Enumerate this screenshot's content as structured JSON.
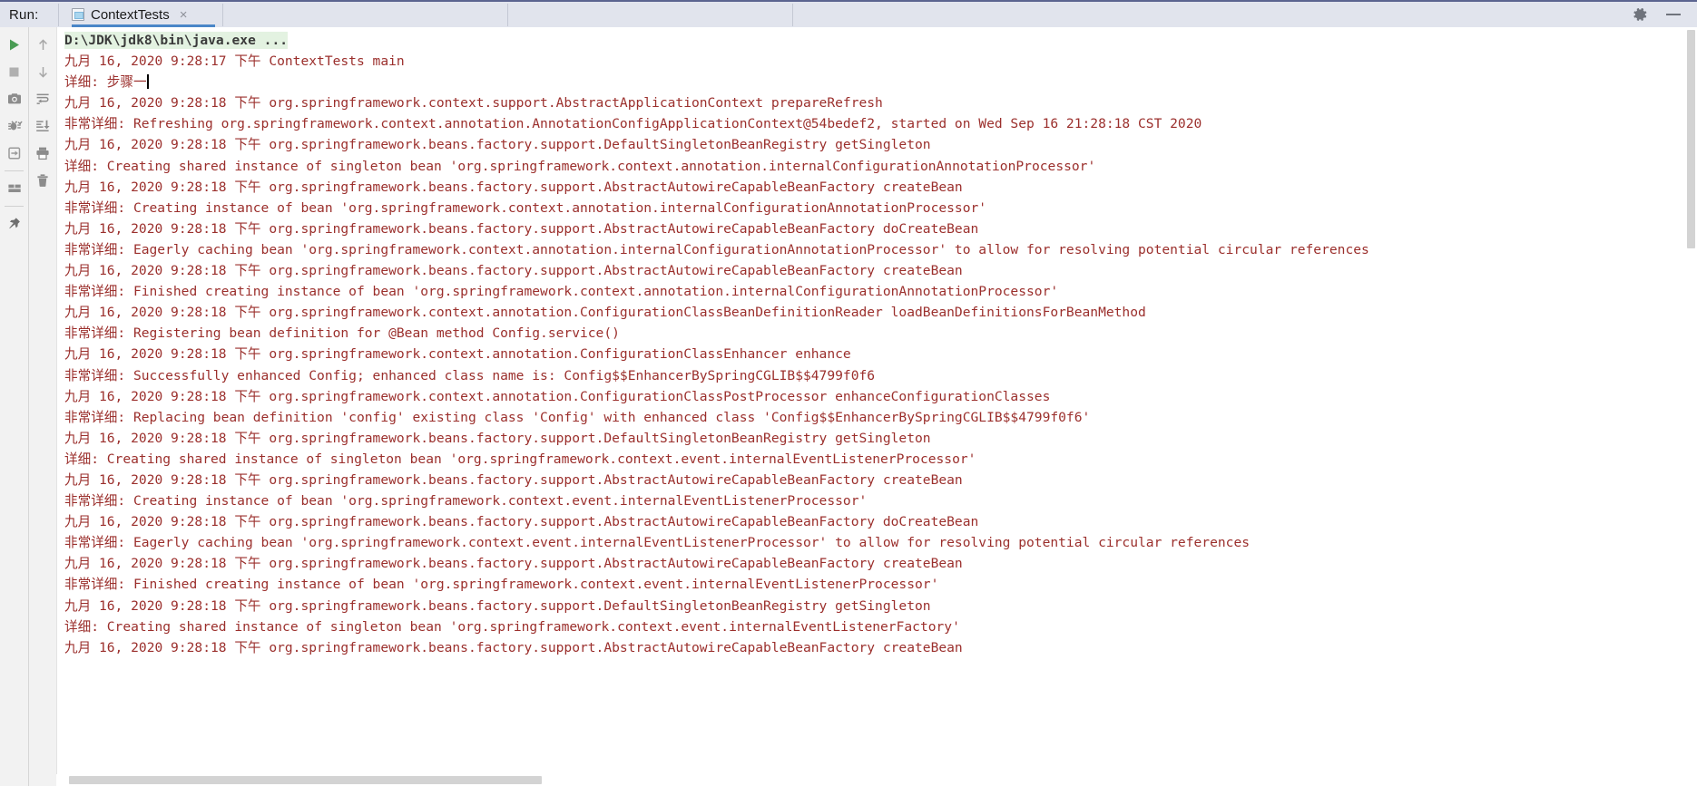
{
  "window": {
    "tool_label": "Run:",
    "accent_color": "#4a86c8",
    "topbar_color": "#e1e4ed",
    "console_text_color": "#9b2f2c"
  },
  "tabs": [
    {
      "label": "ContextTests",
      "close": "×",
      "active": true
    }
  ],
  "titlebar_actions": [
    {
      "name": "settings",
      "icon": "gear-icon"
    },
    {
      "name": "minimize",
      "icon": "minimize-icon"
    }
  ],
  "left_toolbar": {
    "column_one": [
      {
        "name": "rerun",
        "icon": "play-icon",
        "tooltip": "Rerun"
      },
      {
        "name": "stop",
        "icon": "stop-icon",
        "tooltip": "Stop"
      },
      {
        "name": "screenshot",
        "icon": "camera-icon",
        "tooltip": "Screenshot"
      },
      {
        "name": "threaddump",
        "icon": "thread-dump-icon",
        "tooltip": "Thread Dump"
      },
      {
        "name": "attach",
        "icon": "attach-console-icon",
        "tooltip": "Attach"
      },
      {
        "name": "layout",
        "icon": "layout-icon",
        "tooltip": "Layout Settings"
      },
      {
        "name": "pin",
        "icon": "pin-icon",
        "tooltip": "Pin Tab"
      }
    ],
    "column_two": [
      {
        "name": "prev-occurrence",
        "icon": "arrow-up-icon",
        "tooltip": "Up the Stack Trace"
      },
      {
        "name": "next-occurrence",
        "icon": "arrow-down-icon",
        "tooltip": "Down the Stack Trace"
      },
      {
        "name": "soft-wrap",
        "icon": "soft-wrap-icon",
        "tooltip": "Soft-Wrap"
      },
      {
        "name": "scroll-to-end",
        "icon": "scroll-to-end-icon",
        "tooltip": "Scroll to the End"
      },
      {
        "name": "print",
        "icon": "print-icon",
        "tooltip": "Print"
      },
      {
        "name": "clear-all",
        "icon": "trash-icon",
        "tooltip": "Clear All"
      }
    ]
  },
  "console": {
    "lines": [
      {
        "text": "D:\\JDK\\jdk8\\bin\\java.exe ...",
        "style": "command"
      },
      {
        "text": "九月 16, 2020 9:28:17 下午 ContextTests main",
        "style": "log"
      },
      {
        "text": "详细: 步骤一",
        "style": "log",
        "caret": true
      },
      {
        "text": "九月 16, 2020 9:28:18 下午 org.springframework.context.support.AbstractApplicationContext prepareRefresh",
        "style": "log"
      },
      {
        "text": "非常详细: Refreshing org.springframework.context.annotation.AnnotationConfigApplicationContext@54bedef2, started on Wed Sep 16 21:28:18 CST 2020",
        "style": "log"
      },
      {
        "text": "九月 16, 2020 9:28:18 下午 org.springframework.beans.factory.support.DefaultSingletonBeanRegistry getSingleton",
        "style": "log"
      },
      {
        "text": "详细: Creating shared instance of singleton bean 'org.springframework.context.annotation.internalConfigurationAnnotationProcessor'",
        "style": "log"
      },
      {
        "text": "九月 16, 2020 9:28:18 下午 org.springframework.beans.factory.support.AbstractAutowireCapableBeanFactory createBean",
        "style": "log"
      },
      {
        "text": "非常详细: Creating instance of bean 'org.springframework.context.annotation.internalConfigurationAnnotationProcessor'",
        "style": "log"
      },
      {
        "text": "九月 16, 2020 9:28:18 下午 org.springframework.beans.factory.support.AbstractAutowireCapableBeanFactory doCreateBean",
        "style": "log"
      },
      {
        "text": "非常详细: Eagerly caching bean 'org.springframework.context.annotation.internalConfigurationAnnotationProcessor' to allow for resolving potential circular references",
        "style": "log"
      },
      {
        "text": "九月 16, 2020 9:28:18 下午 org.springframework.beans.factory.support.AbstractAutowireCapableBeanFactory createBean",
        "style": "log"
      },
      {
        "text": "非常详细: Finished creating instance of bean 'org.springframework.context.annotation.internalConfigurationAnnotationProcessor'",
        "style": "log"
      },
      {
        "text": "九月 16, 2020 9:28:18 下午 org.springframework.context.annotation.ConfigurationClassBeanDefinitionReader loadBeanDefinitionsForBeanMethod",
        "style": "log"
      },
      {
        "text": "非常详细: Registering bean definition for @Bean method Config.service()",
        "style": "log"
      },
      {
        "text": "九月 16, 2020 9:28:18 下午 org.springframework.context.annotation.ConfigurationClassEnhancer enhance",
        "style": "log"
      },
      {
        "text": "非常详细: Successfully enhanced Config; enhanced class name is: Config$$EnhancerBySpringCGLIB$$4799f0f6",
        "style": "log"
      },
      {
        "text": "九月 16, 2020 9:28:18 下午 org.springframework.context.annotation.ConfigurationClassPostProcessor enhanceConfigurationClasses",
        "style": "log"
      },
      {
        "text": "非常详细: Replacing bean definition 'config' existing class 'Config' with enhanced class 'Config$$EnhancerBySpringCGLIB$$4799f0f6'",
        "style": "log"
      },
      {
        "text": "九月 16, 2020 9:28:18 下午 org.springframework.beans.factory.support.DefaultSingletonBeanRegistry getSingleton",
        "style": "log"
      },
      {
        "text": "详细: Creating shared instance of singleton bean 'org.springframework.context.event.internalEventListenerProcessor'",
        "style": "log"
      },
      {
        "text": "九月 16, 2020 9:28:18 下午 org.springframework.beans.factory.support.AbstractAutowireCapableBeanFactory createBean",
        "style": "log"
      },
      {
        "text": "非常详细: Creating instance of bean 'org.springframework.context.event.internalEventListenerProcessor'",
        "style": "log"
      },
      {
        "text": "九月 16, 2020 9:28:18 下午 org.springframework.beans.factory.support.AbstractAutowireCapableBeanFactory doCreateBean",
        "style": "log"
      },
      {
        "text": "非常详细: Eagerly caching bean 'org.springframework.context.event.internalEventListenerProcessor' to allow for resolving potential circular references",
        "style": "log"
      },
      {
        "text": "九月 16, 2020 9:28:18 下午 org.springframework.beans.factory.support.AbstractAutowireCapableBeanFactory createBean",
        "style": "log"
      },
      {
        "text": "非常详细: Finished creating instance of bean 'org.springframework.context.event.internalEventListenerProcessor'",
        "style": "log"
      },
      {
        "text": "九月 16, 2020 9:28:18 下午 org.springframework.beans.factory.support.DefaultSingletonBeanRegistry getSingleton",
        "style": "log"
      },
      {
        "text": "详细: Creating shared instance of singleton bean 'org.springframework.context.event.internalEventListenerFactory'",
        "style": "log"
      },
      {
        "text": "九月 16, 2020 9:28:18 下午 org.springframework.beans.factory.support.AbstractAutowireCapableBeanFactory createBean",
        "style": "log"
      }
    ]
  },
  "scrollbars": {
    "vertical": {
      "thumb_top_pct": 0.4,
      "thumb_height_pct": 28.7
    },
    "horizontal": {
      "thumb_left_pct": 0.8,
      "thumb_width_pct": 29.0
    }
  }
}
